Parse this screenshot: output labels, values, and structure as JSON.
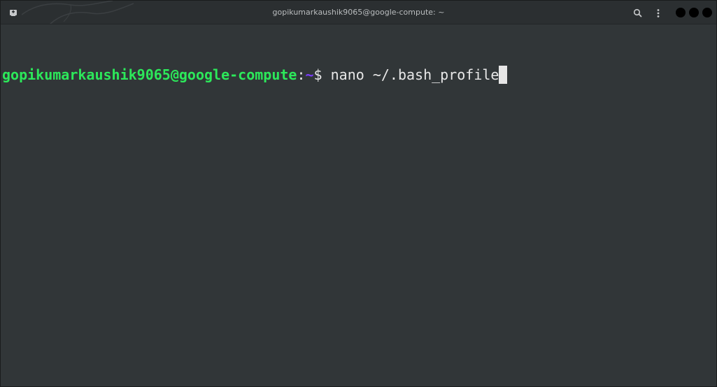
{
  "window": {
    "title": "gopikumarkaushik9065@google-compute: ~"
  },
  "titlebar": {
    "left_icon": "new-tab-icon",
    "search_icon": "search-icon",
    "menu_icon": "kebab-menu-icon",
    "window_controls": [
      "minimize",
      "maximize",
      "close"
    ]
  },
  "terminal": {
    "prompt_user_host": "gopikumarkaushik9065@google-compute",
    "prompt_colon": ":",
    "prompt_path": "~",
    "prompt_symbol": "$ ",
    "command": "nano ~/.bash_profile"
  },
  "colors": {
    "background": "#313638",
    "titlebar": "#2b2f31",
    "user_host": "#2ce85a",
    "path": "#7c3cff",
    "text": "#e8e8e8"
  }
}
